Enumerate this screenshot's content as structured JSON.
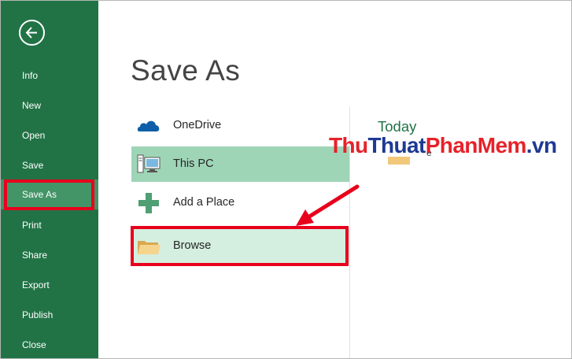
{
  "sidebar": {
    "items": [
      {
        "label": "Info"
      },
      {
        "label": "New"
      },
      {
        "label": "Open"
      },
      {
        "label": "Save"
      },
      {
        "label": "Save As",
        "active": true
      },
      {
        "label": "Print"
      },
      {
        "label": "Share"
      },
      {
        "label": "Export"
      },
      {
        "label": "Publish"
      },
      {
        "label": "Close"
      }
    ]
  },
  "main": {
    "title": "Save As",
    "locations": [
      {
        "label": "OneDrive",
        "icon": "cloud-icon"
      },
      {
        "label": "This PC",
        "icon": "computer-icon",
        "selected": true
      },
      {
        "label": "Add a Place",
        "icon": "plus-icon"
      },
      {
        "label": "Browse",
        "icon": "folder-icon"
      }
    ],
    "recent": {
      "heading": "Today",
      "item": "e"
    }
  },
  "watermark": {
    "part1": "Thu",
    "part2": "Thuat",
    "part3": "PhanMem",
    "part4": ".vn"
  },
  "colors": {
    "accent": "#217346",
    "active_item": "#439467",
    "selected_location": "#9fd5b7",
    "browse_location": "#d4efe0",
    "highlight": "#e8001c"
  }
}
